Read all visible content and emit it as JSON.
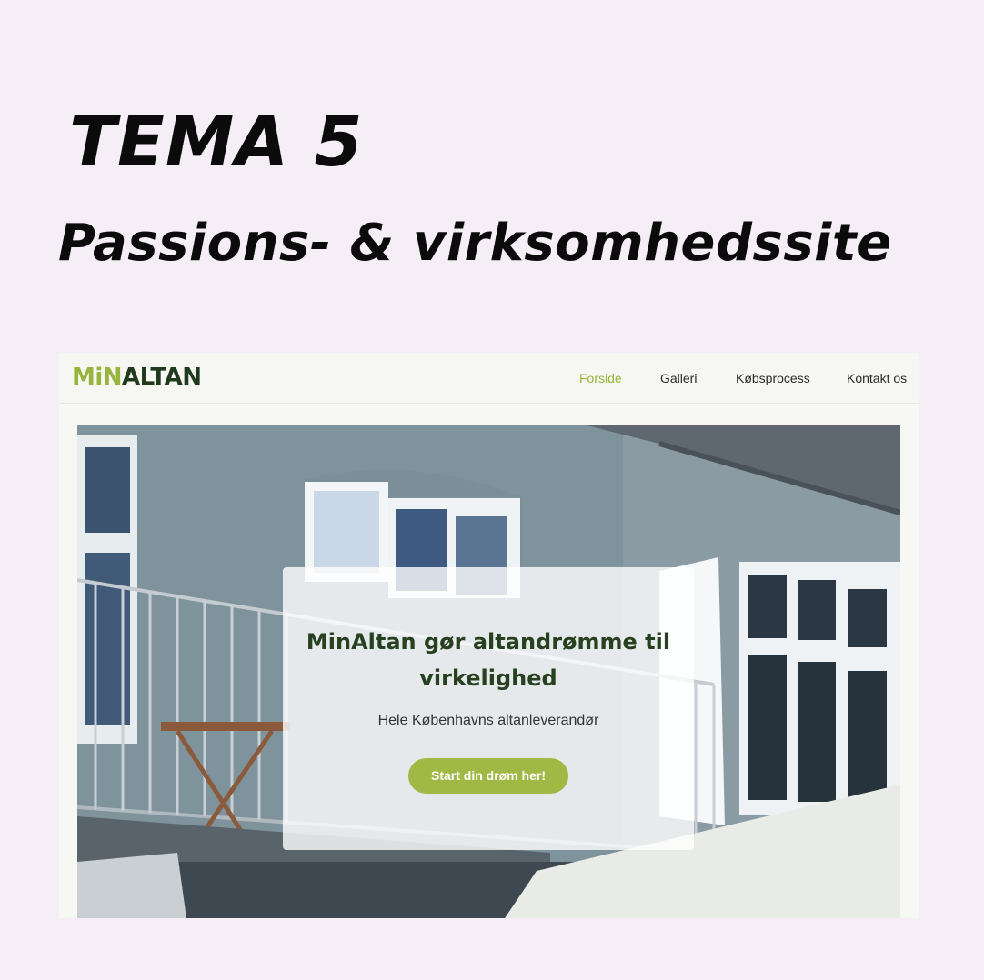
{
  "heading": {
    "title": "TEMA 5",
    "subtitle": "Passions- & virksomhedssite"
  },
  "site": {
    "logo": {
      "part1": "MiN",
      "part2": "ALTAN"
    },
    "nav": [
      {
        "label": "Forside",
        "active": true
      },
      {
        "label": "Galleri",
        "active": false
      },
      {
        "label": "Købsprocess",
        "active": false
      },
      {
        "label": "Kontakt os",
        "active": false
      }
    ],
    "hero": {
      "heading": "MinAltan gør altandrømme til virkelighed",
      "subheading": "Hele Københavns altanleverandør",
      "cta_label": "Start din drøm her!"
    }
  },
  "colors": {
    "background": "#f5eef7",
    "accent": "#97b43c",
    "dark_green": "#1f3a1d",
    "button": "#9fb944"
  }
}
